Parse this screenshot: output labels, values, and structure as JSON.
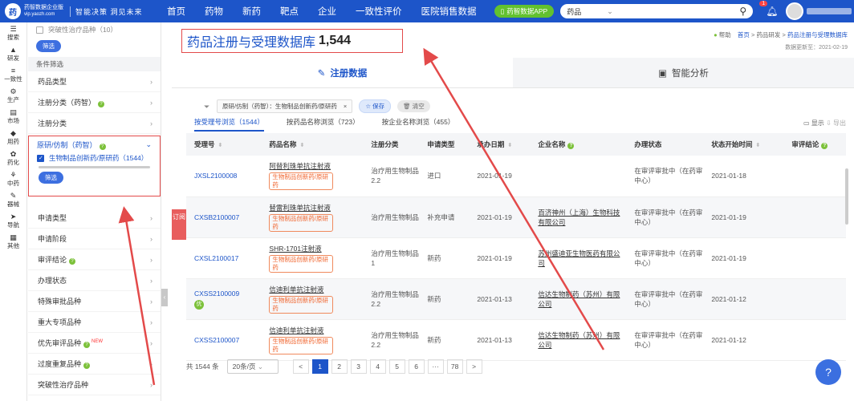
{
  "top": {
    "logo_mark": "药",
    "logo_name": "药智数据企业版",
    "logo_url": "vip.yaozh.com",
    "slogan": "智能决策 洞见未来",
    "nav": [
      "首页",
      "药物",
      "新药",
      "靶点",
      "企业",
      "一致性评价",
      "医院销售数据"
    ],
    "app_button": "药智数据APP",
    "search_scope": "药品",
    "bell_badge": "1"
  },
  "rail": [
    {
      "icon": "☰",
      "label": "搜索"
    },
    {
      "icon": "▲",
      "label": "研发"
    },
    {
      "icon": "≡",
      "label": "一致性"
    },
    {
      "icon": "⚙",
      "label": "生产"
    },
    {
      "icon": "▤",
      "label": "市场"
    },
    {
      "icon": "◆",
      "label": "用药"
    },
    {
      "icon": "✿",
      "label": "药化"
    },
    {
      "icon": "⚘",
      "label": "中药"
    },
    {
      "icon": "✎",
      "label": "器械"
    },
    {
      "icon": "➤",
      "label": "导航"
    },
    {
      "icon": "▦",
      "label": "其他"
    }
  ],
  "filter": {
    "top_option": "突破性治疗品种（10）",
    "filter_btn": "筛选",
    "section": "条件筛选",
    "rows_a": [
      {
        "label": "药品类型",
        "q": false
      },
      {
        "label": "注册分类（药智）",
        "q": true
      },
      {
        "label": "注册分类",
        "q": false
      }
    ],
    "open": {
      "label": "原研/仿制（药智）",
      "option": "生物制品创新药/原研药（1544）",
      "btn": "筛选"
    },
    "rows_b": [
      {
        "label": "申请类型",
        "q": false,
        "new": ""
      },
      {
        "label": "申请阶段",
        "q": false,
        "new": ""
      },
      {
        "label": "审评结论",
        "q": true,
        "new": ""
      },
      {
        "label": "办理状态",
        "q": false,
        "new": ""
      },
      {
        "label": "特殊审批品种",
        "q": false,
        "new": ""
      },
      {
        "label": "重大专项品种",
        "q": false,
        "new": ""
      },
      {
        "label": "优先审评品种",
        "q": true,
        "new": "NEW"
      },
      {
        "label": "过度重复品种",
        "q": true,
        "new": ""
      },
      {
        "label": "突破性治疗品种",
        "q": false,
        "new": ""
      }
    ]
  },
  "main": {
    "title": "药品注册与受理数据库",
    "count": "1,544",
    "crumb": {
      "help": "帮助",
      "home": "首页",
      "mid": "药品研发",
      "current": "药品注册与受理数据库"
    },
    "update": "数据更新至：2021-02-19",
    "tabs": [
      {
        "icon": "✎",
        "label": "注册数据"
      },
      {
        "icon": "▣",
        "label": "智能分析"
      }
    ],
    "chip": "原研/仿制（药智）：生物制品创新药/原研药",
    "save": "保存",
    "clear": "清空",
    "subtabs": [
      "按受理号浏览（1544）",
      "按药品名称浏览（723）",
      "按企业名称浏览（455）"
    ],
    "display": "显示",
    "export": "导出",
    "columns": [
      "受理号",
      "药品名称",
      "注册分类",
      "申请类型",
      "承办日期",
      "企业名称",
      "办理状态",
      "状态开始时间",
      "审评结论"
    ],
    "rows": [
      {
        "code": "JXSL2100008",
        "name": "阿替利珠单抗注射液",
        "tag": "生物制品创新药/原研药",
        "cls": "治疗用生物制品2.2",
        "type": "进口",
        "date": "2021-01-19",
        "company": "",
        "status": "在审评审批中（在药审中心）",
        "since": "2021-01-18",
        "badge": ""
      },
      {
        "code": "CXSB2100007",
        "name": "替雷利珠单抗注射液",
        "tag": "生物制品创新药/原研药",
        "cls": "治疗用生物制品",
        "type": "补充申请",
        "date": "2021-01-19",
        "company": "百济神州（上海）生物科技有限公司",
        "status": "在审评审批中（在药审中心）",
        "since": "2021-01-19",
        "badge": ""
      },
      {
        "code": "CXSL2100017",
        "name": "SHR-1701注射液",
        "tag": "生物制品创新药/原研药",
        "cls": "治疗用生物制品1",
        "type": "新药",
        "date": "2021-01-19",
        "company": "苏州盛迪亚生物医药有限公司",
        "status": "在审评审批中（在药审中心）",
        "since": "2021-01-19",
        "badge": ""
      },
      {
        "code": "CXSS2100009",
        "name": "信迪利单抗注射液",
        "tag": "生物制品创新药/原研药",
        "cls": "治疗用生物制品2.2",
        "type": "新药",
        "date": "2021-01-13",
        "company": "信达生物制药（苏州）有限公司",
        "status": "在审评审批中（在药审中心）",
        "since": "2021-01-12",
        "badge": "优"
      },
      {
        "code": "CXSS2100007",
        "name": "信迪利单抗注射液",
        "tag": "生物制品创新药/原研药",
        "cls": "治疗用生物制品2.2",
        "type": "新药",
        "date": "2021-01-13",
        "company": "信达生物制药（苏州）有限公司",
        "status": "在审评审批中（在药审中心）",
        "since": "2021-01-12",
        "badge": ""
      }
    ],
    "subscribe": "订阅",
    "pager": {
      "total": "共 1544 条",
      "size": "20条/页",
      "pages": [
        "1",
        "2",
        "3",
        "4",
        "5",
        "6",
        "···",
        "78"
      ],
      "prev": "<",
      "next": ">"
    }
  },
  "colors": {
    "brand": "#1d55c9",
    "highlight": "#e34a4a",
    "tag": "#f0642d",
    "green": "#7cc13a"
  }
}
